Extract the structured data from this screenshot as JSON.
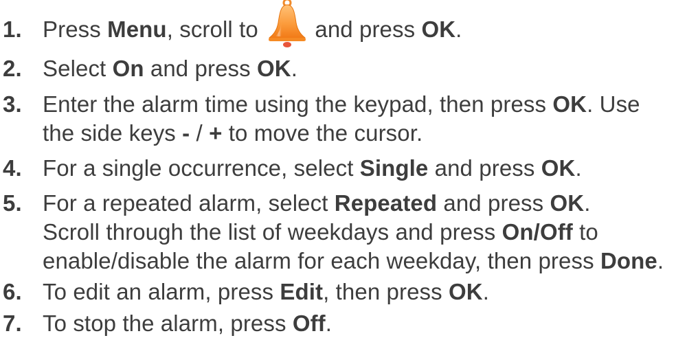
{
  "steps": [
    {
      "number": "1.",
      "parts": {
        "a": "Press ",
        "b": "Menu",
        "c": ", scroll to ",
        "d": " and press ",
        "e": "OK",
        "f": "."
      }
    },
    {
      "number": "2.",
      "parts": {
        "a": "Select ",
        "b": "On",
        "c": " and press ",
        "d": "OK",
        "e": "."
      }
    },
    {
      "number": "3.",
      "line1": {
        "a": "Enter the alarm time using the keypad, then press ",
        "b": "OK",
        "c": ". Use"
      },
      "line2": {
        "a": "the side keys ",
        "b": "-",
        "c": " / ",
        "d": "+",
        "e": " to move the cursor."
      }
    },
    {
      "number": "4.",
      "parts": {
        "a": "For a single occurrence, select ",
        "b": "Single",
        "c": " and press ",
        "d": "OK",
        "e": "."
      }
    },
    {
      "number": "5.",
      "line1": {
        "a": "For a repeated alarm, select ",
        "b": "Repeated",
        "c": " and press ",
        "d": "OK",
        "e": "."
      },
      "line2": {
        "a": "Scroll through the list of weekdays and press ",
        "b": "On",
        "c": "/",
        "d": "Off",
        "e": " to"
      },
      "line3": {
        "a": "enable/disable the alarm for each weekday, then press ",
        "b": "Done",
        "c": "."
      }
    },
    {
      "number": "6.",
      "parts": {
        "a": "To edit an alarm, press ",
        "b": "Edit",
        "c": ", then press ",
        "d": "OK",
        "e": "."
      }
    },
    {
      "number": "7.",
      "parts": {
        "a": "To stop the alarm, press ",
        "b": "Off",
        "c": "."
      }
    }
  ],
  "icons": {
    "alarm_bell": "alarm-bell-icon"
  },
  "colors": {
    "text": "#3d3d3d",
    "bell_top": "#ffb35a",
    "bell_bottom": "#f07a10",
    "bell_clapper": "#e8553a"
  }
}
